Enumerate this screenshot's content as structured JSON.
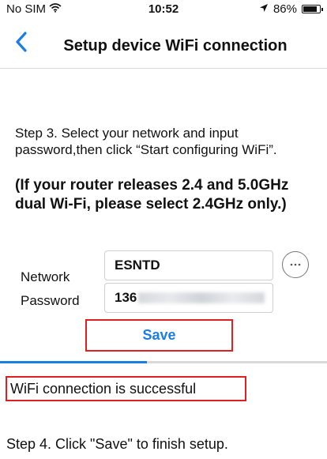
{
  "status_bar": {
    "carrier": "No SIM",
    "wifi_icon": "wifi-icon",
    "time": "10:52",
    "location_icon": "location-arrow-icon",
    "battery": "86%",
    "battery_level": 0.86
  },
  "nav": {
    "back_icon": "chevron-left-icon",
    "title": "Setup device WiFi connection"
  },
  "content": {
    "step3": "Step 3. Select your network and input password,then click “Start configuring WiFi”.",
    "warning": "(If your router releases 2.4 and 5.0GHz dual Wi-Fi, please select 2.4GHz only.)"
  },
  "form": {
    "network_label": "Network",
    "network_value": "ESNTD",
    "password_label": "Password",
    "password_value": "136",
    "more_icon": "more-horizontal-icon",
    "save_label": "Save"
  },
  "progress": {
    "fraction": 0.45
  },
  "result": {
    "message": "WiFi connection is successful",
    "step4": "Step 4. Click \"Save\" to finish setup."
  },
  "colors": {
    "accent": "#1a7ee6",
    "highlight_border": "#e02020"
  }
}
